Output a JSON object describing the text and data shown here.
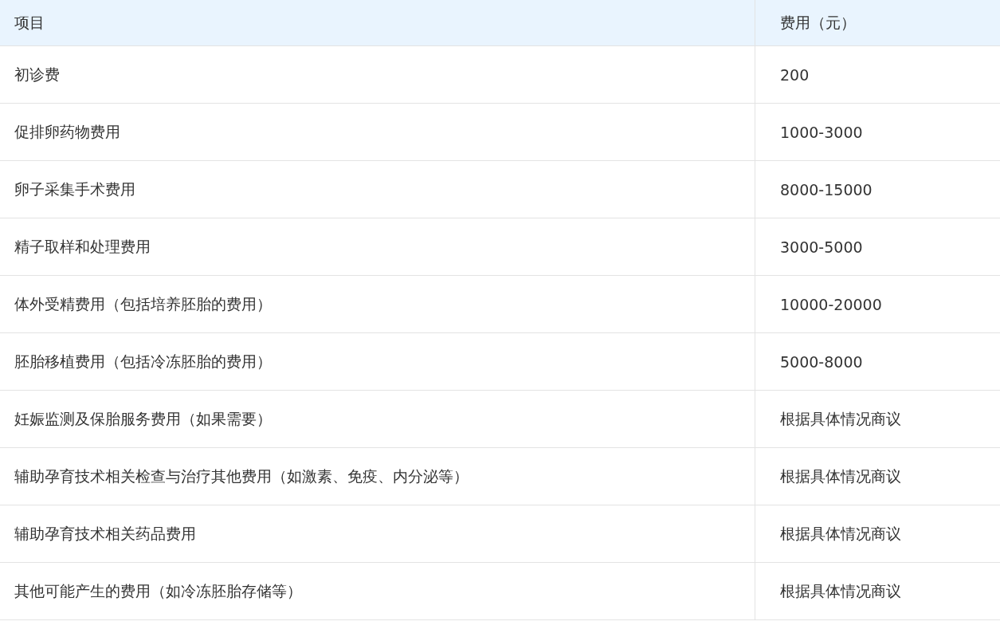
{
  "table": {
    "columns": [
      "项目",
      "费用（元）"
    ],
    "rows": [
      [
        "初诊费",
        "200"
      ],
      [
        "促排卵药物费用",
        "1000-3000"
      ],
      [
        "卵子采集手术费用",
        "8000-15000"
      ],
      [
        "精子取样和处理费用",
        "3000-5000"
      ],
      [
        "体外受精费用（包括培养胚胎的费用）",
        "10000-20000"
      ],
      [
        "胚胎移植费用（包括冷冻胚胎的费用）",
        "5000-8000"
      ],
      [
        "妊娠监测及保胎服务费用（如果需要）",
        "根据具体情况商议"
      ],
      [
        "辅助孕育技术相关检查与治疗其他费用（如激素、免疫、内分泌等）",
        "根据具体情况商议"
      ],
      [
        "辅助孕育技术相关药品费用",
        "根据具体情况商议"
      ],
      [
        "其他可能产生的费用（如冷冻胚胎存储等）",
        "根据具体情况商议"
      ]
    ]
  }
}
